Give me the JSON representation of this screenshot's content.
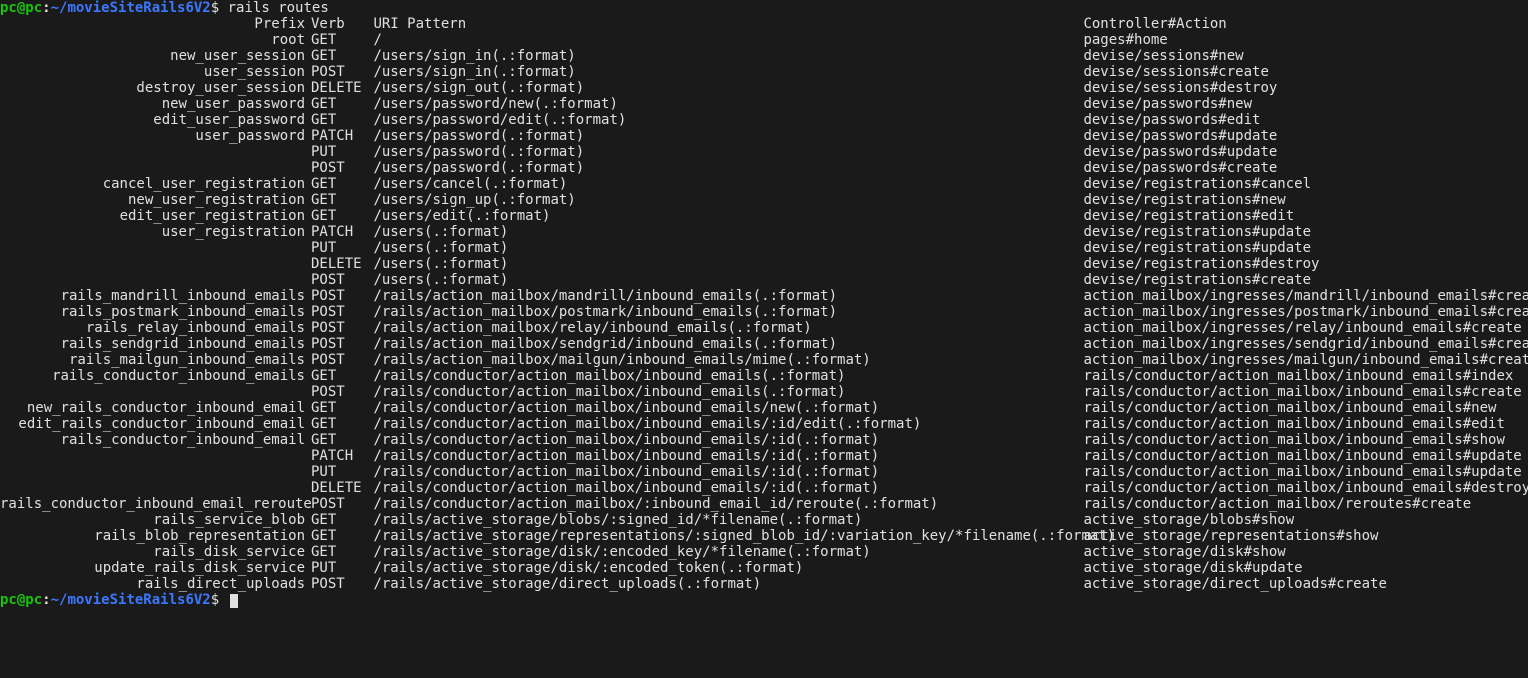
{
  "prompt": {
    "user_host": "pc@pc",
    "path": "~/movieSiteRails6V2",
    "dollar": "$"
  },
  "command": "rails routes",
  "headers": {
    "prefix": "Prefix",
    "verb": "Verb",
    "pattern": "URI Pattern",
    "action": "Controller#Action"
  },
  "routes": [
    {
      "prefix": "root",
      "verb": "GET",
      "pattern": "/",
      "action": "pages#home"
    },
    {
      "prefix": "new_user_session",
      "verb": "GET",
      "pattern": "/users/sign_in(.:format)",
      "action": "devise/sessions#new"
    },
    {
      "prefix": "user_session",
      "verb": "POST",
      "pattern": "/users/sign_in(.:format)",
      "action": "devise/sessions#create"
    },
    {
      "prefix": "destroy_user_session",
      "verb": "DELETE",
      "pattern": "/users/sign_out(.:format)",
      "action": "devise/sessions#destroy"
    },
    {
      "prefix": "new_user_password",
      "verb": "GET",
      "pattern": "/users/password/new(.:format)",
      "action": "devise/passwords#new"
    },
    {
      "prefix": "edit_user_password",
      "verb": "GET",
      "pattern": "/users/password/edit(.:format)",
      "action": "devise/passwords#edit"
    },
    {
      "prefix": "user_password",
      "verb": "PATCH",
      "pattern": "/users/password(.:format)",
      "action": "devise/passwords#update"
    },
    {
      "prefix": "",
      "verb": "PUT",
      "pattern": "/users/password(.:format)",
      "action": "devise/passwords#update"
    },
    {
      "prefix": "",
      "verb": "POST",
      "pattern": "/users/password(.:format)",
      "action": "devise/passwords#create"
    },
    {
      "prefix": "cancel_user_registration",
      "verb": "GET",
      "pattern": "/users/cancel(.:format)",
      "action": "devise/registrations#cancel"
    },
    {
      "prefix": "new_user_registration",
      "verb": "GET",
      "pattern": "/users/sign_up(.:format)",
      "action": "devise/registrations#new"
    },
    {
      "prefix": "edit_user_registration",
      "verb": "GET",
      "pattern": "/users/edit(.:format)",
      "action": "devise/registrations#edit"
    },
    {
      "prefix": "user_registration",
      "verb": "PATCH",
      "pattern": "/users(.:format)",
      "action": "devise/registrations#update"
    },
    {
      "prefix": "",
      "verb": "PUT",
      "pattern": "/users(.:format)",
      "action": "devise/registrations#update"
    },
    {
      "prefix": "",
      "verb": "DELETE",
      "pattern": "/users(.:format)",
      "action": "devise/registrations#destroy"
    },
    {
      "prefix": "",
      "verb": "POST",
      "pattern": "/users(.:format)",
      "action": "devise/registrations#create"
    },
    {
      "prefix": "rails_mandrill_inbound_emails",
      "verb": "POST",
      "pattern": "/rails/action_mailbox/mandrill/inbound_emails(.:format)",
      "action": "action_mailbox/ingresses/mandrill/inbound_emails#create"
    },
    {
      "prefix": "rails_postmark_inbound_emails",
      "verb": "POST",
      "pattern": "/rails/action_mailbox/postmark/inbound_emails(.:format)",
      "action": "action_mailbox/ingresses/postmark/inbound_emails#create"
    },
    {
      "prefix": "rails_relay_inbound_emails",
      "verb": "POST",
      "pattern": "/rails/action_mailbox/relay/inbound_emails(.:format)",
      "action": "action_mailbox/ingresses/relay/inbound_emails#create"
    },
    {
      "prefix": "rails_sendgrid_inbound_emails",
      "verb": "POST",
      "pattern": "/rails/action_mailbox/sendgrid/inbound_emails(.:format)",
      "action": "action_mailbox/ingresses/sendgrid/inbound_emails#create"
    },
    {
      "prefix": "rails_mailgun_inbound_emails",
      "verb": "POST",
      "pattern": "/rails/action_mailbox/mailgun/inbound_emails/mime(.:format)",
      "action": "action_mailbox/ingresses/mailgun/inbound_emails#create"
    },
    {
      "prefix": "rails_conductor_inbound_emails",
      "verb": "GET",
      "pattern": "/rails/conductor/action_mailbox/inbound_emails(.:format)",
      "action": "rails/conductor/action_mailbox/inbound_emails#index"
    },
    {
      "prefix": "",
      "verb": "POST",
      "pattern": "/rails/conductor/action_mailbox/inbound_emails(.:format)",
      "action": "rails/conductor/action_mailbox/inbound_emails#create"
    },
    {
      "prefix": "new_rails_conductor_inbound_email",
      "verb": "GET",
      "pattern": "/rails/conductor/action_mailbox/inbound_emails/new(.:format)",
      "action": "rails/conductor/action_mailbox/inbound_emails#new"
    },
    {
      "prefix": "edit_rails_conductor_inbound_email",
      "verb": "GET",
      "pattern": "/rails/conductor/action_mailbox/inbound_emails/:id/edit(.:format)",
      "action": "rails/conductor/action_mailbox/inbound_emails#edit"
    },
    {
      "prefix": "rails_conductor_inbound_email",
      "verb": "GET",
      "pattern": "/rails/conductor/action_mailbox/inbound_emails/:id(.:format)",
      "action": "rails/conductor/action_mailbox/inbound_emails#show"
    },
    {
      "prefix": "",
      "verb": "PATCH",
      "pattern": "/rails/conductor/action_mailbox/inbound_emails/:id(.:format)",
      "action": "rails/conductor/action_mailbox/inbound_emails#update"
    },
    {
      "prefix": "",
      "verb": "PUT",
      "pattern": "/rails/conductor/action_mailbox/inbound_emails/:id(.:format)",
      "action": "rails/conductor/action_mailbox/inbound_emails#update"
    },
    {
      "prefix": "",
      "verb": "DELETE",
      "pattern": "/rails/conductor/action_mailbox/inbound_emails/:id(.:format)",
      "action": "rails/conductor/action_mailbox/inbound_emails#destroy"
    },
    {
      "prefix": "rails_conductor_inbound_email_reroute",
      "verb": "POST",
      "pattern": "/rails/conductor/action_mailbox/:inbound_email_id/reroute(.:format)",
      "action": "rails/conductor/action_mailbox/reroutes#create"
    },
    {
      "prefix": "rails_service_blob",
      "verb": "GET",
      "pattern": "/rails/active_storage/blobs/:signed_id/*filename(.:format)",
      "action": "active_storage/blobs#show"
    },
    {
      "prefix": "rails_blob_representation",
      "verb": "GET",
      "pattern": "/rails/active_storage/representations/:signed_blob_id/:variation_key/*filename(.:format)",
      "action": "active_storage/representations#show"
    },
    {
      "prefix": "rails_disk_service",
      "verb": "GET",
      "pattern": "/rails/active_storage/disk/:encoded_key/*filename(.:format)",
      "action": "active_storage/disk#show"
    },
    {
      "prefix": "update_rails_disk_service",
      "verb": "PUT",
      "pattern": "/rails/active_storage/disk/:encoded_token(.:format)",
      "action": "active_storage/disk#update"
    },
    {
      "prefix": "rails_direct_uploads",
      "verb": "POST",
      "pattern": "/rails/active_storage/direct_uploads(.:format)",
      "action": "active_storage/direct_uploads#create"
    }
  ]
}
